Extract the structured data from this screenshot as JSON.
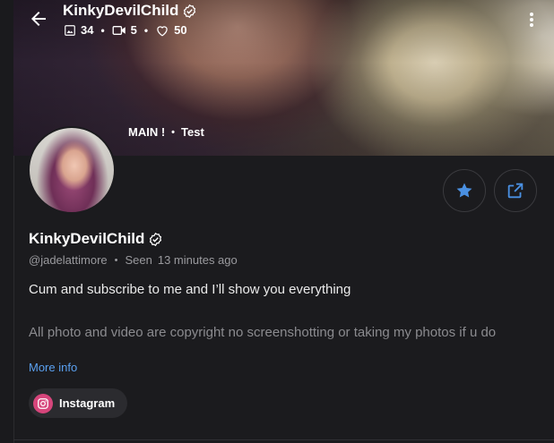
{
  "header": {
    "title": "KinkyDevilChild",
    "stats": {
      "photos": "34",
      "videos": "5",
      "likes": "50"
    }
  },
  "cover_tabs": [
    "MAIN !",
    "Test"
  ],
  "profile": {
    "name": "KinkyDevilChild",
    "handle": "@jadelattimore",
    "seen_label": "Seen",
    "seen_time": "13 minutes ago",
    "bio_line1": "Cum and subscribe to me and I’ll show you everything",
    "bio_line2": "All photo and video are copyright no screenshotting or taking my photos if u do",
    "more_info": "More info",
    "link_label": "Instagram"
  },
  "icons": {
    "back": "arrow-left-icon",
    "verified": "verified-check-icon",
    "photo": "image-icon",
    "video": "video-camera-icon",
    "like": "heart-icon",
    "menu": "more-vertical-icon",
    "favorite": "star-icon",
    "share": "share-icon",
    "instagram": "instagram-icon"
  },
  "colors": {
    "accent": "#4a90e2",
    "link": "#5aa0f0",
    "instagram": "#d6457b",
    "background": "#1b1b1e"
  }
}
